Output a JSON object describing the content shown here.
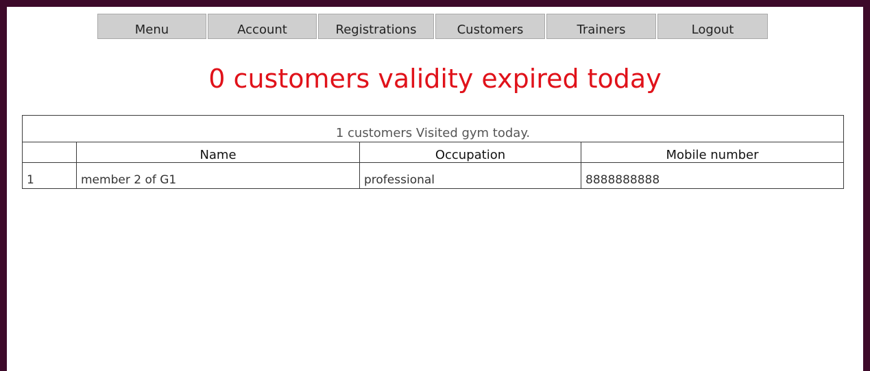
{
  "nav": {
    "items": [
      {
        "label": "Menu"
      },
      {
        "label": "Account"
      },
      {
        "label": "Registrations"
      },
      {
        "label": "Customers"
      },
      {
        "label": "Trainers"
      },
      {
        "label": "Logout"
      }
    ]
  },
  "headline": "0 customers validity expired today",
  "visits_table": {
    "caption": "1 customers Visited gym today.",
    "columns": [
      "",
      "Name",
      "Occupation",
      "Mobile number"
    ],
    "rows": [
      [
        "1",
        "member 2 of G1",
        "professional",
        "8888888888"
      ]
    ]
  },
  "colors": {
    "frame": "#3d0a2a",
    "headline": "#e0121a",
    "nav_button": "#cfcfcf"
  }
}
